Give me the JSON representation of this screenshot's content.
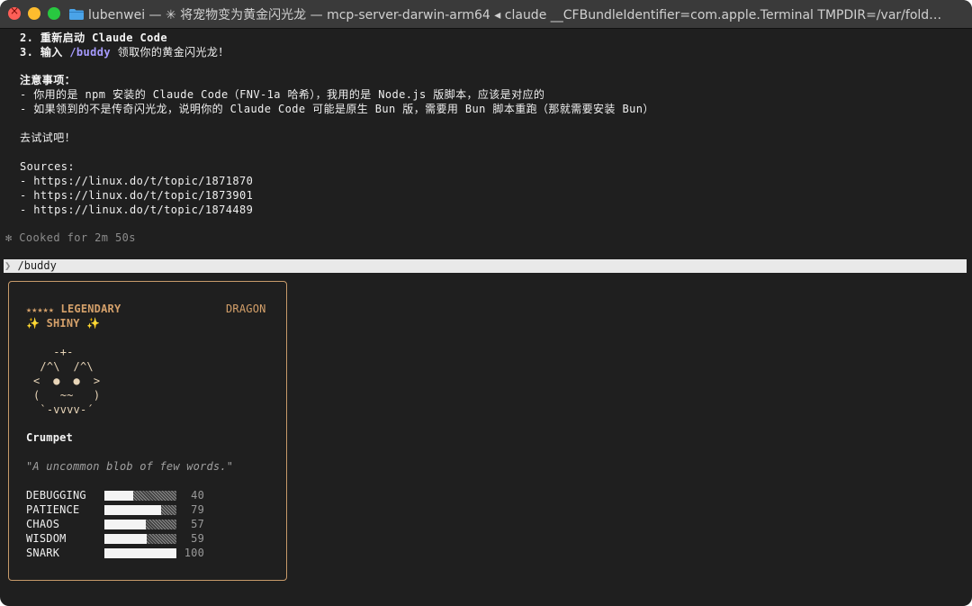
{
  "window": {
    "title": "lubenwei — ✳ 将宠物变为黄金闪光龙 — mcp-server-darwin-arm64 ◂ claude __CFBundleIdentifier=com.apple.Terminal TMPDIR=/var/fold…",
    "folder_icon": "folder-icon"
  },
  "output": {
    "step2_prefix": "2. 重新启动 ",
    "step2_name": "Claude Code",
    "step3_prefix": "3. 输入 ",
    "step3_cmd": "/buddy",
    "step3_suffix": " 领取你的黄金闪光龙！",
    "notes_heading": "注意事项：",
    "note1": "- 你用的是 npm 安装的 Claude Code（FNV-1a 哈希），我用的是 Node.js 版脚本，应该是对应的",
    "note2": "- 如果领到的不是传奇闪光龙，说明你的 Claude Code 可能是原生 Bun 版，需要用 Bun 脚本重跑（那就需要安装 Bun）",
    "go_try": "去试试吧！",
    "sources_heading": "Sources:",
    "sources": [
      "- https://linux.do/t/topic/1871870",
      "- https://linux.do/t/topic/1873901",
      "- https://linux.do/t/topic/1874489"
    ],
    "cooked": "✻ Cooked for 2m 50s"
  },
  "prompt": {
    "chevron": "❯",
    "command": "/buddy"
  },
  "buddy": {
    "rarity_stars": "★★★★★",
    "rarity": "LEGENDARY",
    "species": "DRAGON",
    "shiny": "✨ SHINY ✨",
    "art": [
      "   -+-",
      " /^\\  /^\\",
      "<  ●  ●  >",
      "(   ~~   )",
      " `-vvvv-´"
    ],
    "name": "Crumpet",
    "description": "\"A uncommon blob of few words.\"",
    "stats": [
      {
        "label": "DEBUGGING",
        "value": 40
      },
      {
        "label": "PATIENCE",
        "value": 79
      },
      {
        "label": "CHAOS",
        "value": 57
      },
      {
        "label": "WISDOM",
        "value": 59
      },
      {
        "label": "SNARK",
        "value": 100
      }
    ]
  },
  "colors": {
    "accent_gold": "#d4a06a",
    "command_purple": "#a79bff",
    "background": "#1f1f1f"
  }
}
